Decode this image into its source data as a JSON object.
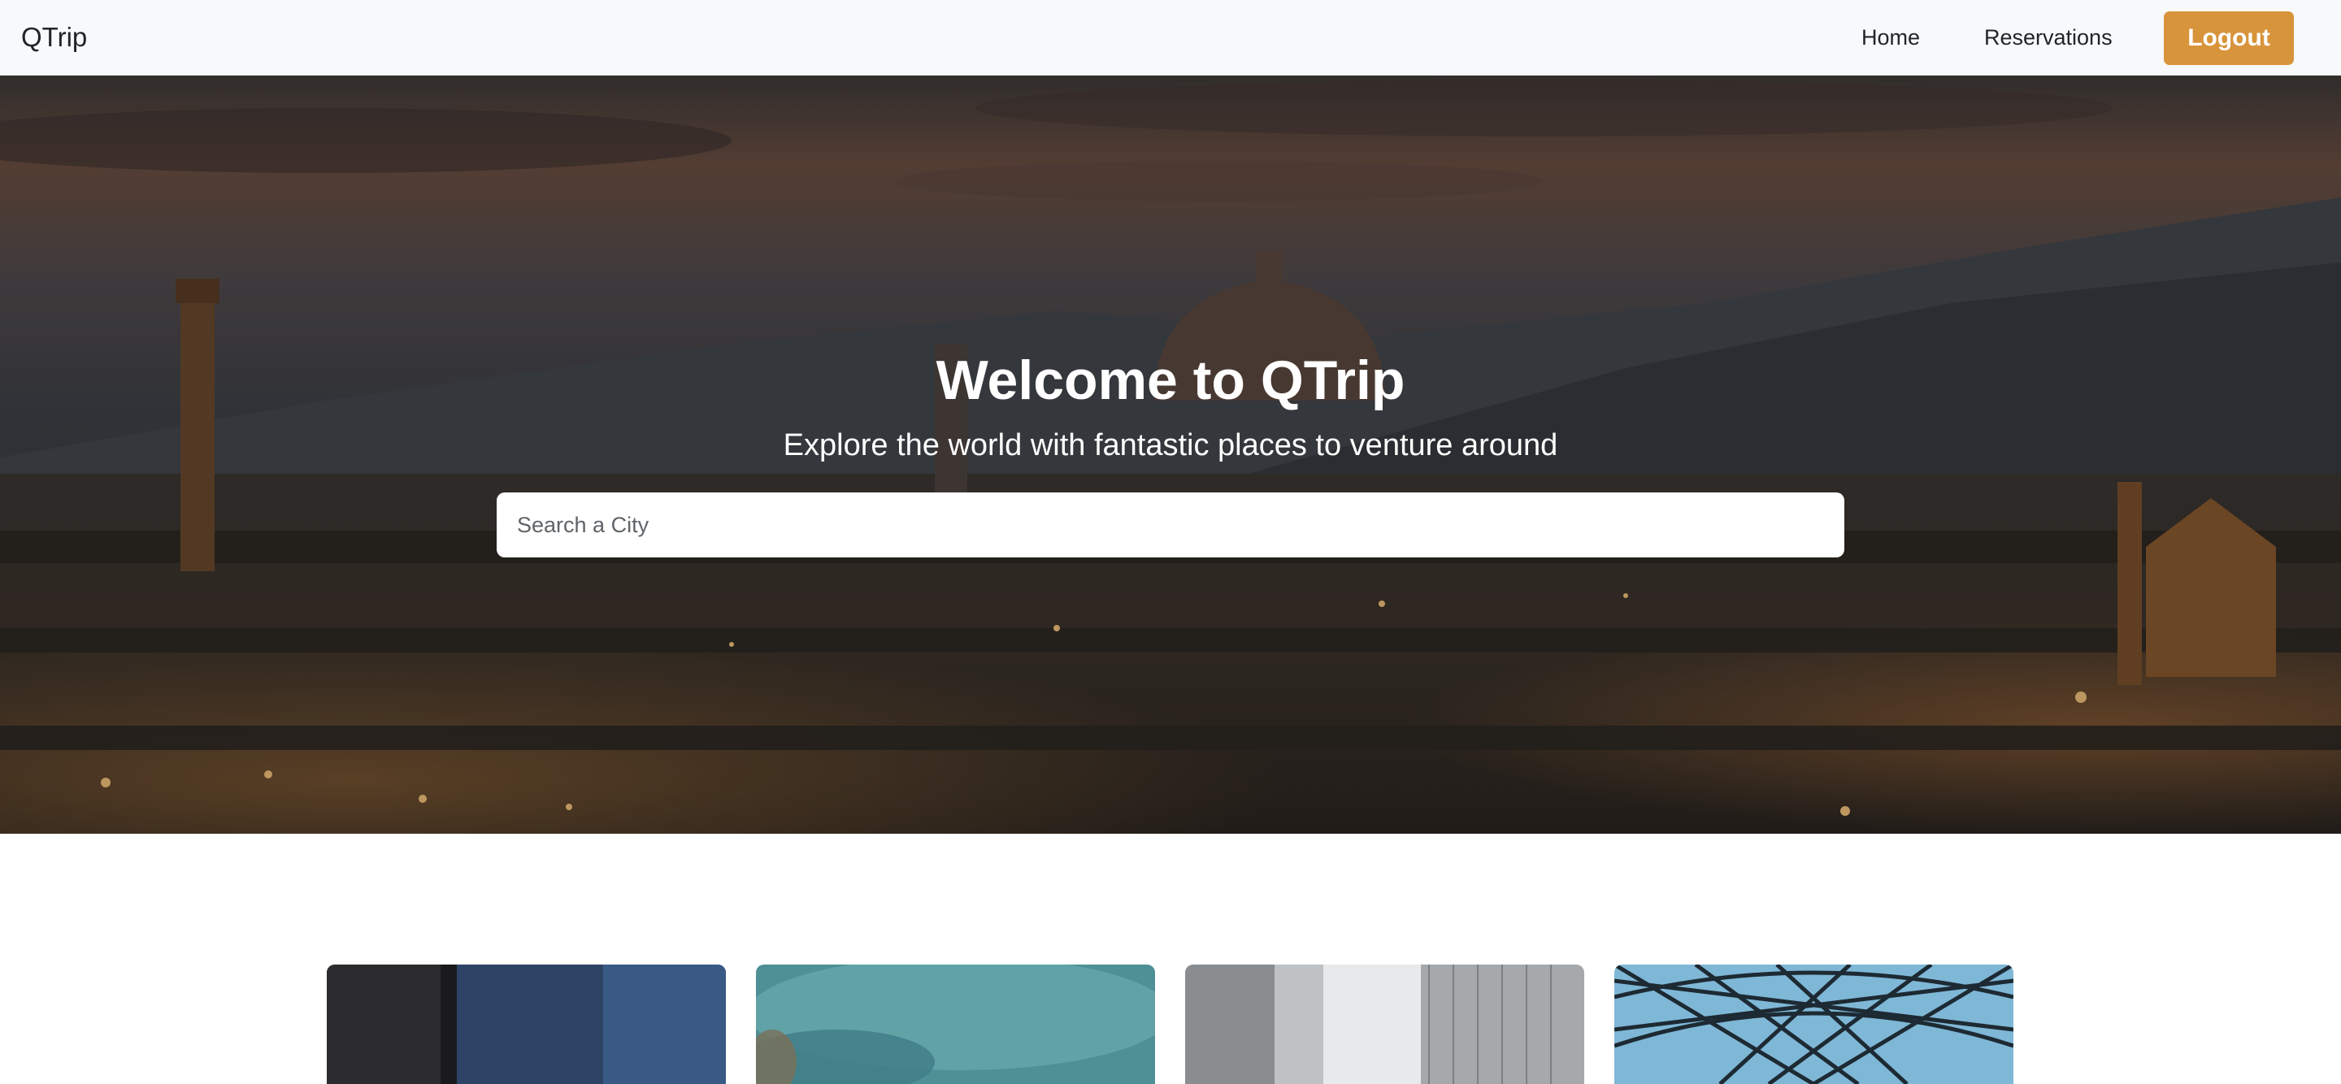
{
  "navbar": {
    "brand": "QTrip",
    "links": [
      {
        "label": "Home"
      },
      {
        "label": "Reservations"
      }
    ],
    "logout_label": "Logout",
    "logout_color": "#d8943a"
  },
  "hero": {
    "title": "Welcome to QTrip",
    "subtitle": "Explore the world with fantastic places to venture around",
    "search": {
      "placeholder": "Search a City",
      "value": ""
    }
  },
  "cards": [
    {
      "image": "city-street-night-image"
    },
    {
      "image": "turquoise-water-image"
    },
    {
      "image": "skyscrapers-image"
    },
    {
      "image": "glass-dome-image"
    }
  ]
}
